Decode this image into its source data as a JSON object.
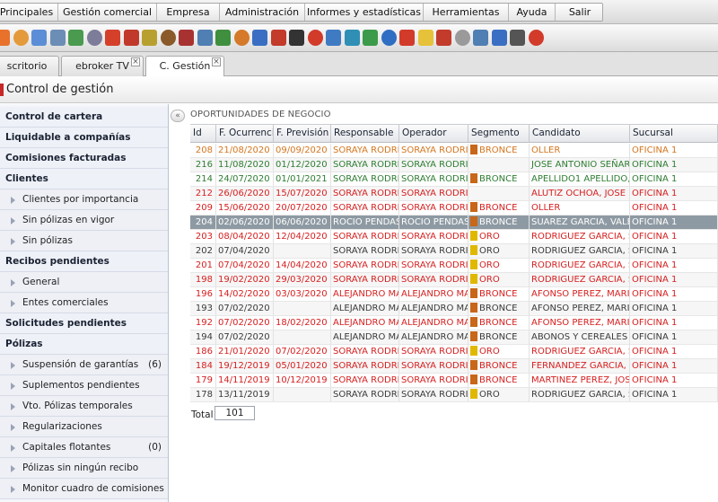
{
  "menu": {
    "items": [
      "Principales",
      "Gestión comercial",
      "Empresa",
      "Administración",
      "Informes y estadísticas",
      "Herramientas",
      "Ayuda",
      "Salir"
    ]
  },
  "toolbar": {
    "icons": [
      {
        "name": "home-icon",
        "color": "#e8712b"
      },
      {
        "name": "user-orange-icon",
        "color": "#e49a3b"
      },
      {
        "name": "user-blue-icon",
        "color": "#5b8ed6"
      },
      {
        "name": "calendar-icon",
        "color": "#6c8db5"
      },
      {
        "name": "grid-icon",
        "color": "#4a9b4f"
      },
      {
        "name": "agenda-icon",
        "color": "#7d7d9a"
      },
      {
        "name": "fire-icon",
        "color": "#d4402a"
      },
      {
        "name": "target-icon",
        "color": "#c0392b"
      },
      {
        "name": "pencil-icon",
        "color": "#b8a030"
      },
      {
        "name": "briefcase-icon",
        "color": "#8a5a2b"
      },
      {
        "name": "case-icon",
        "color": "#a83232"
      },
      {
        "name": "arrows-icon",
        "color": "#4f7fb3"
      },
      {
        "name": "document-green-icon",
        "color": "#3f8f3f"
      },
      {
        "name": "people-icon",
        "color": "#d47a2a"
      },
      {
        "name": "network-icon",
        "color": "#3a6ec2"
      },
      {
        "name": "euro-icon",
        "color": "#c23b2b"
      },
      {
        "name": "eye-icon",
        "color": "#333333"
      },
      {
        "name": "globe-red-icon",
        "color": "#d23a2a"
      },
      {
        "name": "globe-blue-icon",
        "color": "#3f7bc2"
      },
      {
        "name": "diamond-icon",
        "color": "#2f8fb5"
      },
      {
        "name": "shield-icon",
        "color": "#3b9b4b"
      },
      {
        "name": "browser-icon",
        "color": "#2f6ec2"
      },
      {
        "name": "google-icon",
        "color": "#d23a2a"
      },
      {
        "name": "bulb-icon",
        "color": "#e6c23a"
      },
      {
        "name": "pdf-icon",
        "color": "#c23b2b"
      },
      {
        "name": "notepad-icon",
        "color": "#9a9a9a"
      },
      {
        "name": "edit-doc-icon",
        "color": "#4f7fb3"
      },
      {
        "name": "phone-icon",
        "color": "#3a6ec2"
      },
      {
        "name": "tools-icon",
        "color": "#555555"
      },
      {
        "name": "help-icon",
        "color": "#d23a2a"
      }
    ]
  },
  "tabs": [
    {
      "label": "scritorio",
      "closable": false
    },
    {
      "label": "ebroker TV",
      "closable": true
    },
    {
      "label": "C. Gestión",
      "closable": true,
      "active": true
    }
  ],
  "page": {
    "title": "Control de gestión"
  },
  "sidebar": {
    "items": [
      {
        "label": "Control de cartera",
        "type": "head",
        "count": ""
      },
      {
        "label": "Liquidable a compañías",
        "type": "head",
        "count": ""
      },
      {
        "label": "Comisiones facturadas",
        "type": "head",
        "count": ""
      },
      {
        "label": "Clientes",
        "type": "head",
        "count": ""
      },
      {
        "label": "Clientes por importancia",
        "type": "sub",
        "count": ""
      },
      {
        "label": "Sin pólizas en vigor",
        "type": "sub",
        "count": ""
      },
      {
        "label": "Sin pólizas",
        "type": "sub",
        "count": ""
      },
      {
        "label": "Recibos pendientes",
        "type": "head",
        "count": ""
      },
      {
        "label": "General",
        "type": "sub",
        "count": ""
      },
      {
        "label": "Entes comerciales",
        "type": "sub",
        "count": ""
      },
      {
        "label": "Solicitudes pendientes",
        "type": "head",
        "count": ""
      },
      {
        "label": "Pólizas",
        "type": "head",
        "count": ""
      },
      {
        "label": "Suspensión de garantías",
        "type": "sub",
        "count": "(6)"
      },
      {
        "label": "Suplementos pendientes",
        "type": "sub",
        "count": ""
      },
      {
        "label": "Vto. Pólizas temporales",
        "type": "sub",
        "count": ""
      },
      {
        "label": "Regularizaciones",
        "type": "sub",
        "count": ""
      },
      {
        "label": "Capitales flotantes",
        "type": "sub",
        "count": "(0)"
      },
      {
        "label": "Pólizas sin ningún recibo",
        "type": "sub",
        "count": ""
      },
      {
        "label": "Monitor cuadro de comisiones",
        "type": "sub",
        "count": ""
      }
    ]
  },
  "main": {
    "section_title": "OPORTUNIDADES DE NEGOCIO",
    "columns": [
      "Id",
      "F. Ocurrencia",
      "F. Previsión",
      "Responsable",
      "Operador",
      "Segmento",
      "Candidato",
      "Sucursal"
    ],
    "colors": {
      "orange": "#d4761e",
      "green": "#2e7d32",
      "red": "#d62020",
      "dark": "#3a3a3a",
      "bronce": "#c8661a",
      "oro": "#e0b800"
    },
    "rows": [
      {
        "id": "208",
        "ocurrencia": "21/08/2020",
        "prevision": "09/09/2020",
        "responsable": "SORAYA RODRIGUEZ",
        "operador": "SORAYA RODRIGUEZ",
        "segmento": "BRONCE",
        "candidato": "OLLER",
        "sucursal": "OFICINA 1",
        "tone": "orange"
      },
      {
        "id": "216",
        "ocurrencia": "11/08/2020",
        "prevision": "01/12/2020",
        "responsable": "SORAYA RODRIGUEZ",
        "operador": "SORAYA RODRIGUEZ",
        "segmento": "",
        "candidato": "JOSE ANTONIO SEÑARIS P",
        "sucursal": "OFICINA 1",
        "tone": "green"
      },
      {
        "id": "214",
        "ocurrencia": "24/07/2020",
        "prevision": "01/01/2021",
        "responsable": "SORAYA RODRIGUEZ",
        "operador": "SORAYA RODRIGUEZ",
        "segmento": "BRONCE",
        "candidato": "APELLIDO1 APELLIDO, 2 N",
        "sucursal": "OFICINA 1",
        "tone": "green"
      },
      {
        "id": "212",
        "ocurrencia": "26/06/2020",
        "prevision": "15/07/2020",
        "responsable": "SORAYA RODRIGUEZ",
        "operador": "SORAYA RODRIGUEZ",
        "segmento": "",
        "candidato": "ALUTIZ OCHOA, JOSE MIG",
        "sucursal": "OFICINA 1",
        "tone": "red"
      },
      {
        "id": "209",
        "ocurrencia": "15/06/2020",
        "prevision": "20/07/2020",
        "responsable": "SORAYA RODRIGUEZ",
        "operador": "SORAYA RODRIGUEZ",
        "segmento": "BRONCE",
        "candidato": "OLLER",
        "sucursal": "OFICINA 1",
        "tone": "red"
      },
      {
        "id": "204",
        "ocurrencia": "02/06/2020",
        "prevision": "06/06/2020",
        "responsable": "ROCIO PENDAS",
        "operador": "ROCIO PENDAS",
        "segmento": "BRONCE",
        "candidato": "SUAREZ GARCIA, VALENT",
        "sucursal": "OFICINA 1",
        "tone": "selected"
      },
      {
        "id": "203",
        "ocurrencia": "08/04/2020",
        "prevision": "12/04/2020",
        "responsable": "SORAYA RODRIGUEZ",
        "operador": "SORAYA RODRIGUEZ",
        "segmento": "ORO",
        "candidato": "RODRIGUEZ GARCIA, SOR",
        "sucursal": "OFICINA 1",
        "tone": "red"
      },
      {
        "id": "202",
        "ocurrencia": "07/04/2020",
        "prevision": "",
        "responsable": "SORAYA RODRIGUEZ",
        "operador": "SORAYA RODRIGUEZ",
        "segmento": "ORO",
        "candidato": "RODRIGUEZ GARCIA, SOR",
        "sucursal": "OFICINA 1",
        "tone": "dark"
      },
      {
        "id": "201",
        "ocurrencia": "07/04/2020",
        "prevision": "14/04/2020",
        "responsable": "SORAYA RODRIGUEZ",
        "operador": "SORAYA RODRIGUEZ",
        "segmento": "ORO",
        "candidato": "RODRIGUEZ GARCIA, SOR",
        "sucursal": "OFICINA 1",
        "tone": "red"
      },
      {
        "id": "198",
        "ocurrencia": "19/02/2020",
        "prevision": "29/03/2020",
        "responsable": "SORAYA RODRIGUEZ",
        "operador": "SORAYA RODRIGUEZ",
        "segmento": "ORO",
        "candidato": "RODRIGUEZ GARCIA, SOR",
        "sucursal": "OFICINA 1",
        "tone": "red"
      },
      {
        "id": "196",
        "ocurrencia": "14/02/2020",
        "prevision": "03/03/2020",
        "responsable": "ALEJANDRO MARTIN",
        "operador": "ALEJANDRO MARTIN",
        "segmento": "BRONCE",
        "candidato": "AFONSO PEREZ, MARIA DO",
        "sucursal": "OFICINA 1",
        "tone": "red"
      },
      {
        "id": "193",
        "ocurrencia": "07/02/2020",
        "prevision": "",
        "responsable": "ALEJANDRO MARTIN",
        "operador": "ALEJANDRO MARTIN",
        "segmento": "BRONCE",
        "candidato": "AFONSO PEREZ, MARIA DO",
        "sucursal": "OFICINA 1",
        "tone": "dark"
      },
      {
        "id": "192",
        "ocurrencia": "07/02/2020",
        "prevision": "18/02/2020",
        "responsable": "ALEJANDRO MARTIN",
        "operador": "ALEJANDRO MARTIN",
        "segmento": "BRONCE",
        "candidato": "AFONSO PEREZ, MARIA DO",
        "sucursal": "OFICINA 1",
        "tone": "red"
      },
      {
        "id": "194",
        "ocurrencia": "07/02/2020",
        "prevision": "",
        "responsable": "ALEJANDRO MARTIN",
        "operador": "ALEJANDRO MARTIN",
        "segmento": "BRONCE",
        "candidato": "ABONOS Y CEREALES GAV",
        "sucursal": "OFICINA 1",
        "tone": "dark"
      },
      {
        "id": "186",
        "ocurrencia": "21/01/2020",
        "prevision": "07/02/2020",
        "responsable": "SORAYA RODRIGUEZ",
        "operador": "SORAYA RODRIGUEZ",
        "segmento": "ORO",
        "candidato": "RODRIGUEZ GARCIA, SOR",
        "sucursal": "OFICINA 1",
        "tone": "red"
      },
      {
        "id": "184",
        "ocurrencia": "19/12/2019",
        "prevision": "05/01/2020",
        "responsable": "SORAYA RODRIGUEZ",
        "operador": "SORAYA RODRIGUEZ",
        "segmento": "BRONCE",
        "candidato": "FERNANDEZ GARCIA, ANN",
        "sucursal": "OFICINA 1",
        "tone": "red"
      },
      {
        "id": "179",
        "ocurrencia": "14/11/2019",
        "prevision": "10/12/2019",
        "responsable": "SORAYA RODRIGUEZ",
        "operador": "SORAYA RODRIGUEZ",
        "segmento": "BRONCE",
        "candidato": "MARTINEZ PEREZ, JOSE LU",
        "sucursal": "OFICINA 1",
        "tone": "red"
      },
      {
        "id": "178",
        "ocurrencia": "13/11/2019",
        "prevision": "",
        "responsable": "SORAYA RODRIGUEZ",
        "operador": "SORAYA RODRIGUEZ",
        "segmento": "ORO",
        "candidato": "RODRIGUEZ GARCIA, SOR",
        "sucursal": "OFICINA 1",
        "tone": "dark"
      }
    ],
    "total_label": "Total",
    "total_value": "101"
  }
}
